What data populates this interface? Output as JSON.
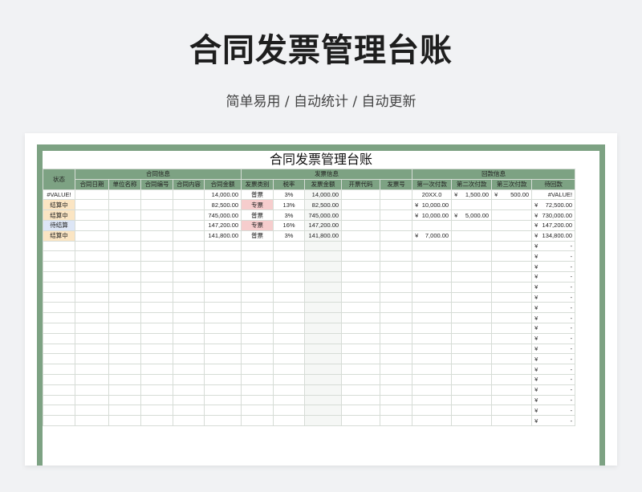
{
  "page": {
    "title": "合同发票管理台账",
    "subtitle": "简单易用 / 自动统计 / 自动更新"
  },
  "sheet": {
    "title": "合同发票管理台账",
    "groups": {
      "status": "状态",
      "contract": "合同信息",
      "invoice": "发票信息",
      "payment": "回款信息"
    },
    "columns": {
      "date": "合同日期",
      "unit": "单位名称",
      "code": "合同编号",
      "content": "合同内容",
      "amount": "合同金额",
      "inv_type": "发票类别",
      "tax": "税率",
      "inv_amount": "发票金额",
      "inv_code": "开票代码",
      "inv_no": "发票号",
      "pay1": "第一次付款",
      "pay2": "第二次付款",
      "pay3": "第三次付款",
      "pending": "待回款"
    },
    "currency": "¥",
    "empty_pending": "-",
    "rows": [
      {
        "status": "#VALUE!",
        "status_color": "",
        "amount": "14,000.00",
        "inv_type": "普票",
        "inv_type_color": "",
        "tax": "3%",
        "inv_amount": "14,000.00",
        "pay1": "20XX.0",
        "pay1_cur": "",
        "pay2": "1,500.00",
        "pay2_cur": "¥",
        "pay3": "500.00",
        "pay3_cur": "¥",
        "pending": "#VALUE!",
        "pending_cur": ""
      },
      {
        "status": "结算中",
        "status_color": "orange",
        "amount": "82,500.00",
        "inv_type": "专票",
        "inv_type_color": "red",
        "tax": "13%",
        "inv_amount": "82,500.00",
        "pay1": "10,000.00",
        "pay1_cur": "¥",
        "pay2": "",
        "pay2_cur": "",
        "pay3": "",
        "pay3_cur": "",
        "pending": "72,500.00",
        "pending_cur": "¥"
      },
      {
        "status": "结算中",
        "status_color": "orange",
        "amount": "745,000.00",
        "inv_type": "普票",
        "inv_type_color": "",
        "tax": "3%",
        "inv_amount": "745,000.00",
        "pay1": "10,000.00",
        "pay1_cur": "¥",
        "pay2": "5,000.00",
        "pay2_cur": "¥",
        "pay3": "",
        "pay3_cur": "",
        "pending": "730,000.00",
        "pending_cur": "¥"
      },
      {
        "status": "待结算",
        "status_color": "blue",
        "amount": "147,200.00",
        "inv_type": "专票",
        "inv_type_color": "red",
        "tax": "16%",
        "inv_amount": "147,200.00",
        "pay1": "",
        "pay1_cur": "",
        "pay2": "",
        "pay2_cur": "",
        "pay3": "",
        "pay3_cur": "",
        "pending": "147,200.00",
        "pending_cur": "¥"
      },
      {
        "status": "结算中",
        "status_color": "orange",
        "amount": "141,800.00",
        "inv_type": "普票",
        "inv_type_color": "",
        "tax": "3%",
        "inv_amount": "141,800.00",
        "pay1": "7,000.00",
        "pay1_cur": "¥",
        "pay2": "",
        "pay2_cur": "",
        "pay3": "",
        "pay3_cur": "",
        "pending": "134,800.00",
        "pending_cur": "¥"
      }
    ],
    "empty_row_count": 18
  }
}
